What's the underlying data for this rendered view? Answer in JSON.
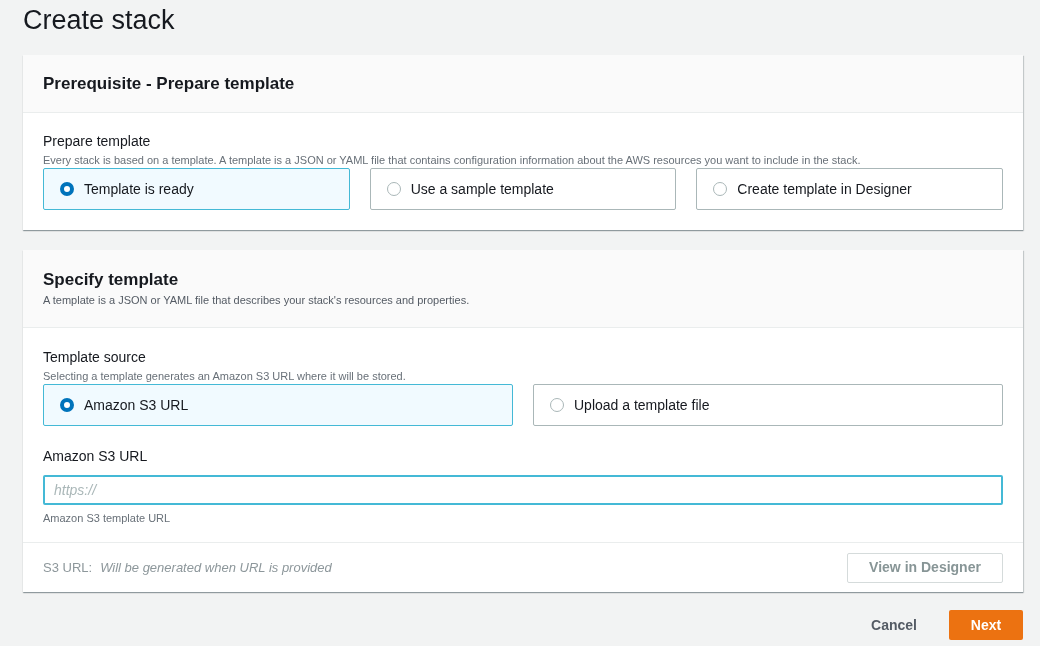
{
  "page_title": "Create stack",
  "prerequisite": {
    "title": "Prerequisite - Prepare template",
    "field_label": "Prepare template",
    "description": "Every stack is based on a template. A template is a JSON or YAML file that contains configuration information about the AWS resources you want to include in the stack.",
    "options": [
      {
        "label": "Template is ready",
        "selected": true
      },
      {
        "label": "Use a sample template",
        "selected": false
      },
      {
        "label": "Create template in Designer",
        "selected": false
      }
    ]
  },
  "specify": {
    "title": "Specify template",
    "description": "A template is a JSON or YAML file that describes your stack's resources and properties.",
    "field_label": "Template source",
    "field_description": "Selecting a template generates an Amazon S3 URL where it will be stored.",
    "options": [
      {
        "label": "Amazon S3 URL",
        "selected": true
      },
      {
        "label": "Upload a template file",
        "selected": false
      }
    ],
    "url_field": {
      "label": "Amazon S3 URL",
      "placeholder": "https://",
      "hint": "Amazon S3 template URL"
    },
    "s3_url": {
      "label": "S3 URL:",
      "value": "Will be generated when URL is provided"
    },
    "designer_button": {
      "label": "View in Designer",
      "disabled": true
    }
  },
  "actions": {
    "cancel": "Cancel",
    "next": "Next"
  }
}
